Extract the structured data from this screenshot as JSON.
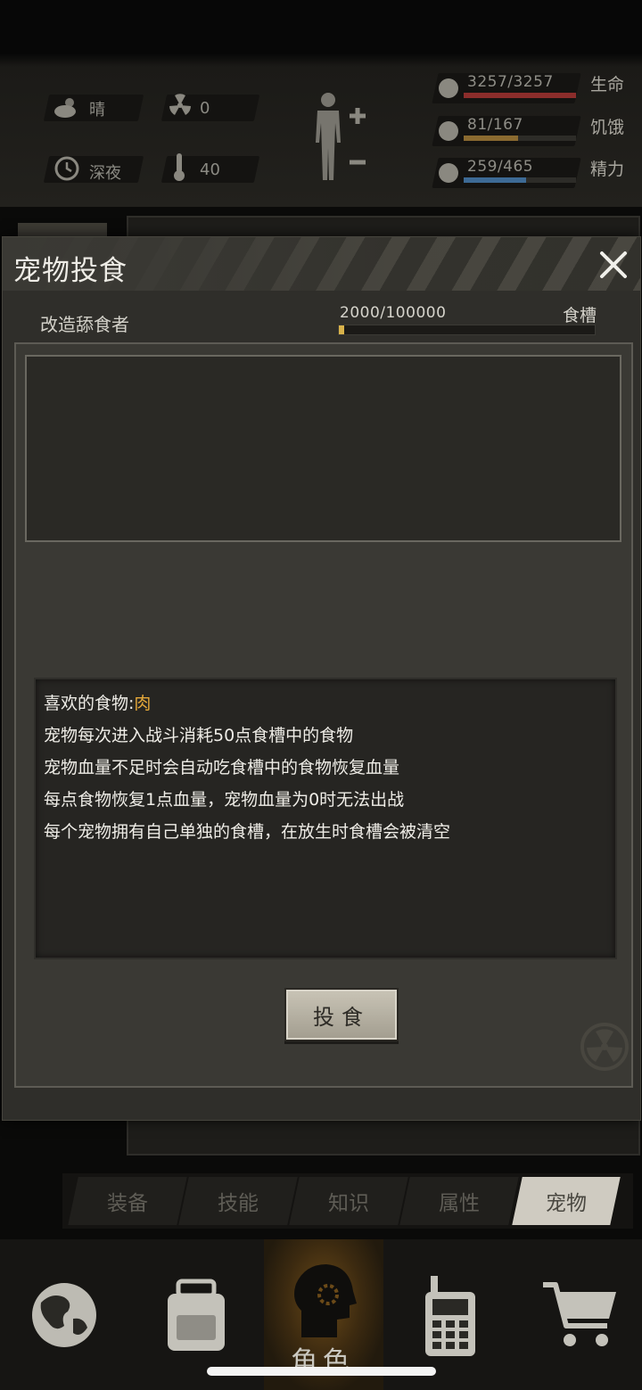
{
  "status_bar": {
    "weather": "晴",
    "radiation": "0",
    "time_of_day": "深夜",
    "temperature": "40",
    "stats": [
      {
        "label": "生命",
        "value": "3257/3257",
        "fraction": 1.0,
        "color": "#8b2d2b"
      },
      {
        "label": "饥饿",
        "value": "81/167",
        "fraction": 0.485,
        "color": "#8a6a30"
      },
      {
        "label": "精力",
        "value": "259/465",
        "fraction": 0.557,
        "color": "#3d6a95"
      }
    ]
  },
  "modal": {
    "title": "宠物投食",
    "pet_name": "改造舔食者",
    "trough": {
      "value": "2000/100000",
      "label": "食槽",
      "fraction": 0.02
    },
    "description": {
      "favorite_label": "喜欢的食物:",
      "favorite_food": "肉",
      "lines": [
        "宠物每次进入战斗消耗50点食槽中的食物",
        "宠物血量不足时会自动吃食槽中的食物恢复血量",
        "每点食物恢复1点血量，宠物血量为0时无法出战",
        "每个宠物拥有自己单独的食槽，在放生时食槽会被清空"
      ]
    },
    "feed_button": "投食"
  },
  "tabs": [
    {
      "label": "装备",
      "active": false
    },
    {
      "label": "技能",
      "active": false
    },
    {
      "label": "知识",
      "active": false
    },
    {
      "label": "属性",
      "active": false
    },
    {
      "label": "宠物",
      "active": true
    }
  ],
  "bottom_nav": {
    "items": [
      "globe-icon",
      "backpack-icon",
      "character-icon",
      "radio-icon",
      "cart-icon"
    ],
    "active_label": "角色"
  }
}
